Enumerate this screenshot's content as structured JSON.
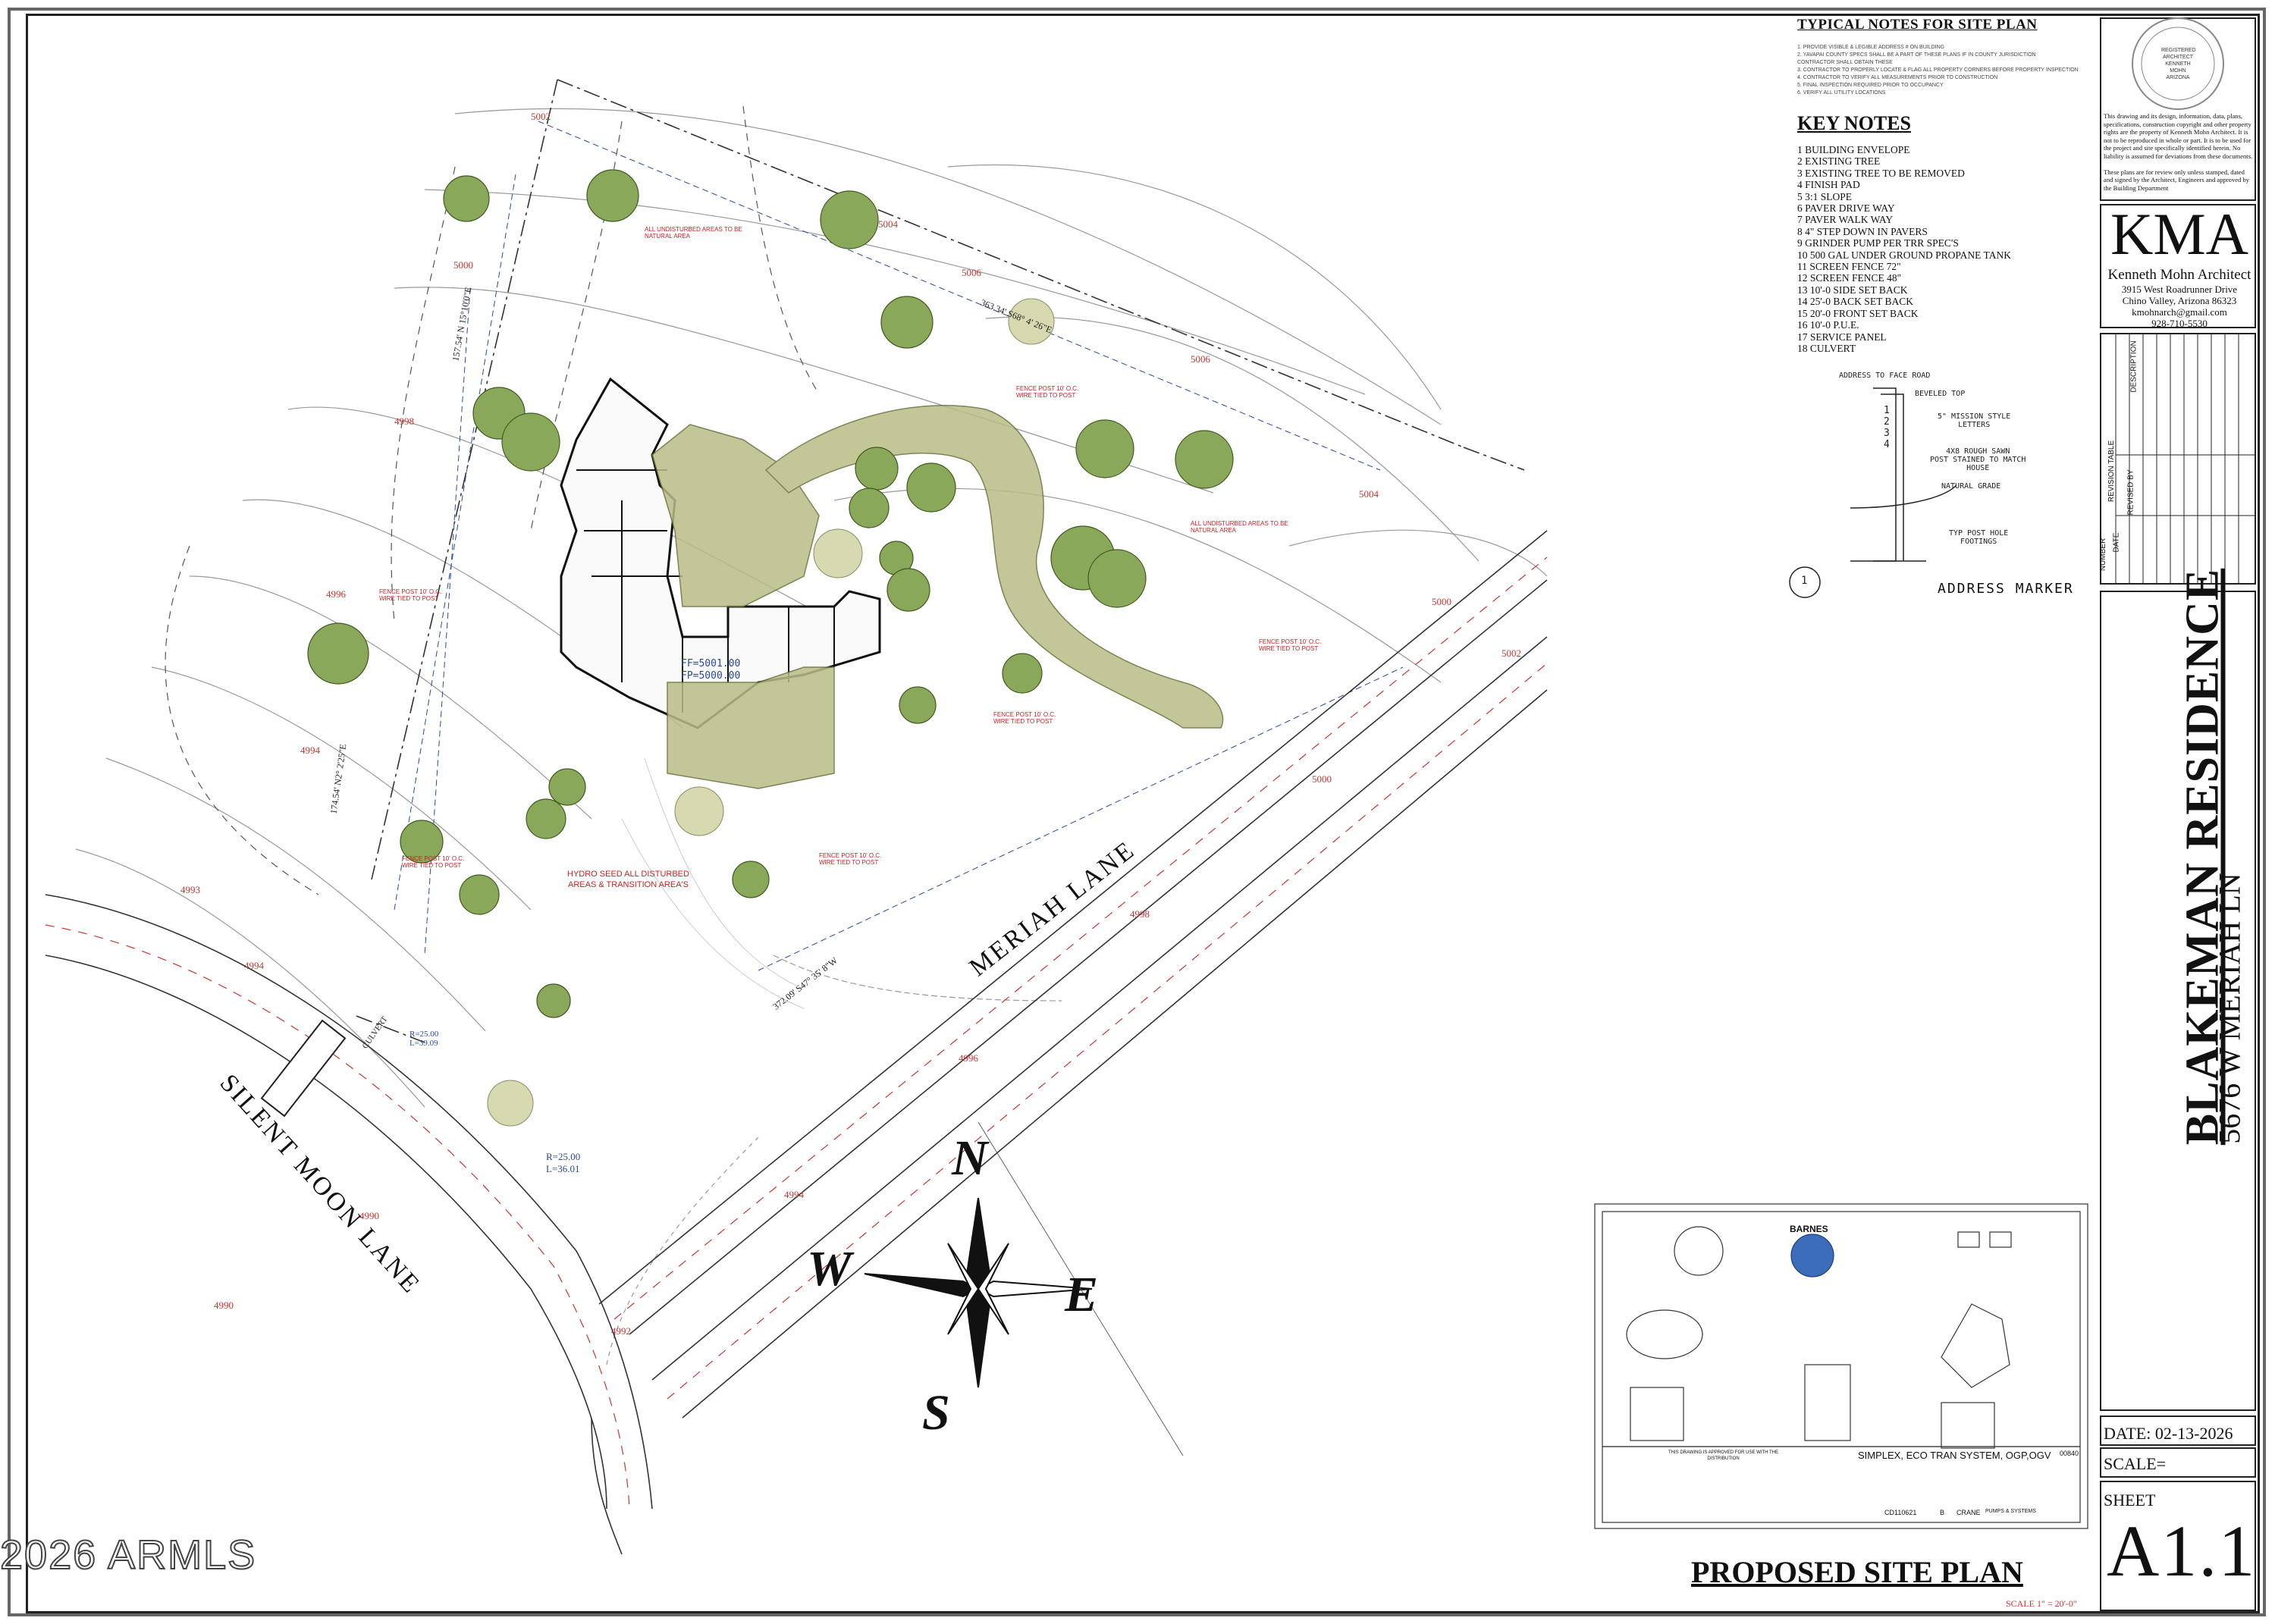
{
  "watermark": "2026 ARMLS",
  "typical_notes": {
    "title": "TYPICAL NOTES FOR SITE PLAN",
    "items": [
      "1. PROVIDE VISIBLE & LEGIBLE ADDRESS # ON BUILDING",
      "2. YAVAPAI COUNTY SPECS SHALL BE A PART OF THESE PLANS IF IN COUNTY JURISDICTION",
      "   CONTRACTOR SHALL OBTAIN THESE",
      "3. CONTRACTOR TO PROPERLY LOCATE & FLAG ALL PROPERTY CORNERS BEFORE PROPERTY INSPECTION",
      "4. CONTRACTOR TO VERIFY ALL MEASUREMENTS PRIOR TO CONSTRUCTION",
      "5. FINAL INSPECTION REQUIRED PRIOR TO OCCUPANCY",
      "6. VERIFY ALL UTILITY LOCATIONS"
    ]
  },
  "key_notes": {
    "title": "KEY NOTES",
    "items": [
      "1 BUILDING ENVELOPE",
      "2 EXISTING TREE",
      "3 EXISTING TREE TO BE REMOVED",
      "4 FINISH PAD",
      "5 3:1 SLOPE",
      "6 PAVER DRIVE WAY",
      "7 PAVER WALK WAY",
      "8 4\" STEP DOWN IN PAVERS",
      "9 GRINDER PUMP PER TRR SPEC'S",
      "10 500 GAL UNDER GROUND PROPANE TANK",
      "11 SCREEN FENCE 72\"",
      "12 SCREEN FENCE 48\"",
      "13 10'-0 SIDE SET BACK",
      "14 25'-0 BACK SET BACK",
      "15 20'-0 FRONT SET BACK",
      "16 10'-0 P.U.E.",
      "17 SERVICE PANEL",
      "18 CULVERT"
    ]
  },
  "address_marker": {
    "title": "ADDRESS MARKER",
    "detail_number": "1",
    "labels": {
      "face_road": "ADDRESS TO FACE ROAD",
      "beveled": "BEVELED TOP",
      "letters": "5\" MISSION STYLE\nLETTERS",
      "post": "4X8 ROUGH SAWN\nPOST STAINED TO MATCH\nHOUSE",
      "grade": "NATURAL GRADE",
      "footing": "TYP POST HOLE\nFOOTINGS"
    },
    "digits": [
      "1",
      "2",
      "3",
      "4"
    ]
  },
  "stamp_text": "This drawing and its design, information, data, plans, specifications, construction copyright and other property rights are the property of Kenneth Mohn Architect. It is not to be reproduced in whole or part. It is to be used for the project and site specifically identified herein. No liability is assumed for deviations from these documents.\n\nThese plans are for review only unless stamped, dated and signed by the Architect, Engineers and approved by the Building Department",
  "seal": {
    "text": "REGISTERED ARCHITECT\nKENNETH\nMOHN\nARIZONA"
  },
  "firm": {
    "logo": "KMA",
    "name": "Kenneth Mohn Architect",
    "address1": "3915 West Roadrunner Drive",
    "address2": "Chino Valley, Arizona 86323",
    "email": "kmohnarch@gmail.com",
    "phone": "928-710-5530"
  },
  "revision_table": {
    "title": "REVISION TABLE",
    "headers": [
      "NUMBER",
      "DATE",
      "REVISED BY",
      "DESCRIPTION"
    ]
  },
  "project": {
    "title": "BLAKEMAN RESIDENCE",
    "address": "5676 W MERIAH LN"
  },
  "date": "DATE: 02-13-2026",
  "scale": "SCALE=",
  "sheet_label": "SHEET",
  "sheet_number": "A1.1",
  "plan_title": "PROPOSED SITE PLAN",
  "plan_scale": "SCALE 1\" = 20'-0\"",
  "compass": {
    "n": "N",
    "s": "S",
    "e": "E",
    "w": "W"
  },
  "streets": {
    "meriah": "MERIAH LANE",
    "silent_moon": "SILENT MOON LANE"
  },
  "site_labels": {
    "ff1": "FF=5001.00",
    "ff2": "FP=5000.00",
    "hydro": "HYDRO SEED ALL DISTURBED\nAREAS & TRANSITION AREA'S",
    "curve1": "R=25.00\nL=36.01",
    "curve2": "R=25.00\nL=39.09",
    "culvert": "CULVERT",
    "bearing1": "363.34' S68° 4' 26\"E",
    "bearing2": "372.09' S47° 35' 8\"W",
    "bearing3": "157.54' N 15°10'0\"E",
    "bearing4": "174.54' N2° 2'25\"E",
    "fence_note": "FENCE POST 10' O.C.\nWIRE TIED TO POST",
    "disturbed_note": "ALL UNDISTURBED AREAS TO BE\nNATURAL AREA"
  },
  "elevations": [
    {
      "label": "5002"
    },
    {
      "label": "5000"
    },
    {
      "label": "5004"
    },
    {
      "label": "5006"
    },
    {
      "label": "5006"
    },
    {
      "label": "5004"
    },
    {
      "label": "5002"
    },
    {
      "label": "5000"
    },
    {
      "label": "5000"
    },
    {
      "label": "4998"
    },
    {
      "label": "4996"
    },
    {
      "label": "4994"
    },
    {
      "label": "4993"
    },
    {
      "label": "4994"
    },
    {
      "label": "4998"
    },
    {
      "label": "4996"
    },
    {
      "label": "4994"
    },
    {
      "label": "4990"
    },
    {
      "label": "4990"
    },
    {
      "label": "4992"
    }
  ],
  "pump_sheet": {
    "brand": "BARNES",
    "system": "SIMPLEX, ECO TRAN SYSTEM, OGP,OGV",
    "code": "CD110621",
    "sheet": "00840",
    "rev": "B",
    "dept": "CRANE",
    "series": "PUMPS & SYSTEMS",
    "notes": "THIS DRAWING IS APPROVED FOR USE WITH THE\nDISTRIBUTION"
  },
  "colors": {
    "accent_red": "#c33333",
    "paver": "#b9bd85",
    "line_blue": "#2a4aa0",
    "tree": "#8aa85a"
  }
}
